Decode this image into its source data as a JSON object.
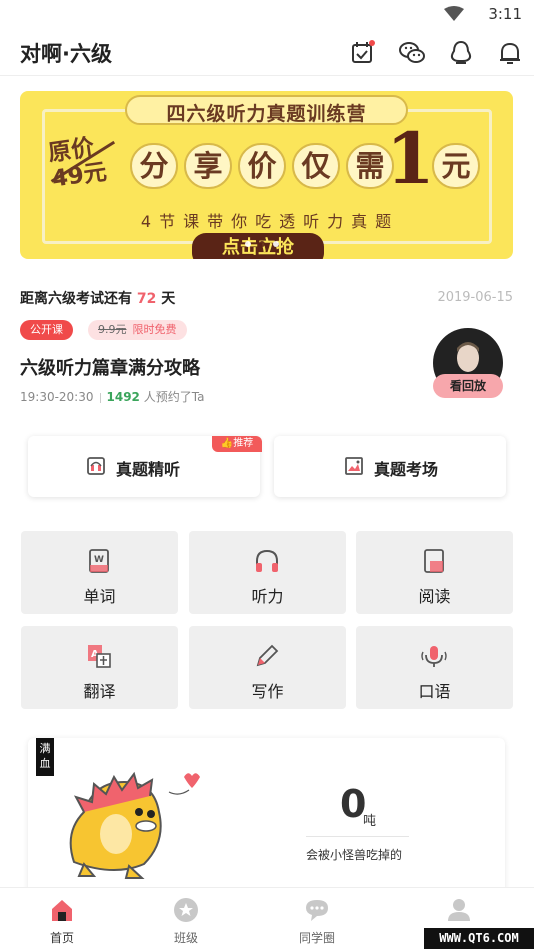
{
  "status_bar": {
    "time": "3:11"
  },
  "header": {
    "title": "对啊·六级"
  },
  "banner": {
    "title": "四六级听力真题训练营",
    "original_price_label": "原价",
    "original_price": "49元",
    "share_chars": [
      "分",
      "享",
      "价",
      "仅",
      "需"
    ],
    "big_digit": "1",
    "yuan": "元",
    "subtitle": "4节课带你吃透听力真题",
    "button": "点击立抢",
    "dots": 3,
    "active_dot": 1
  },
  "countdown": {
    "prefix": "距离六级考试还有",
    "days": "72",
    "suffix": "天",
    "date": "2019-06-15"
  },
  "course": {
    "tag_public": "公开课",
    "tag_price": "9.9元",
    "tag_free": "限时免费",
    "title": "六级听力篇章满分攻略",
    "time": "19:30-20:30",
    "count": "1492",
    "count_suffix": "人预约了Ta",
    "replay": "看回放"
  },
  "big_cards": [
    {
      "label": "真题精听",
      "badge": "推荐"
    },
    {
      "label": "真题考场"
    }
  ],
  "grid": [
    {
      "label": "单词",
      "icon": "word-book-icon"
    },
    {
      "label": "听力",
      "icon": "headphones-icon"
    },
    {
      "label": "阅读",
      "icon": "reading-book-icon"
    },
    {
      "label": "翻译",
      "icon": "translate-icon"
    },
    {
      "label": "写作",
      "icon": "pencil-icon"
    },
    {
      "label": "口语",
      "icon": "microphone-icon"
    }
  ],
  "monster": {
    "status": "满血",
    "value": "0",
    "unit": "吨",
    "label": "会被小怪兽吃掉的"
  },
  "bottom_nav": [
    {
      "label": "首页",
      "icon": "home-icon",
      "active": true
    },
    {
      "label": "班级",
      "icon": "star-icon",
      "active": false
    },
    {
      "label": "同学圈",
      "icon": "chat-bubble-icon",
      "active": false
    },
    {
      "label": "",
      "icon": "user-icon",
      "active": false
    }
  ],
  "watermark": "WWW.QT6.COM",
  "colors": {
    "accent": "#f0636d",
    "banner": "#fbe55a",
    "brown": "#5a2416",
    "green": "#3ba55c"
  }
}
